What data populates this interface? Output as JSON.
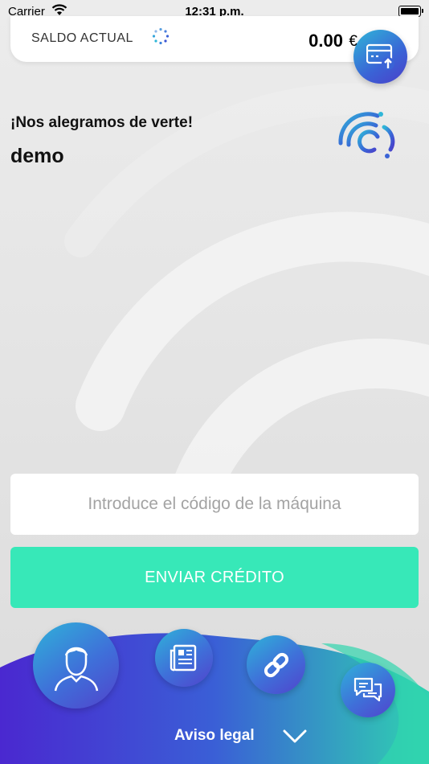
{
  "status_bar": {
    "carrier": "Carrier",
    "time": "12:31 p.m."
  },
  "balance": {
    "label": "SALDO ACTUAL",
    "amount": "0.00",
    "currency": "€",
    "topup_icon": "card-upload-icon"
  },
  "welcome": {
    "greeting": "¡Nos alegramos de verte!",
    "username": "demo"
  },
  "code_entry": {
    "placeholder": "Introduce el código de la máquina",
    "value": ""
  },
  "send_button": {
    "label": "ENVIAR CRÉDITO"
  },
  "bottom_nav": {
    "items": [
      {
        "name": "profile",
        "icon": "user-icon"
      },
      {
        "name": "news",
        "icon": "newspaper-icon"
      },
      {
        "name": "links",
        "icon": "link-icon"
      },
      {
        "name": "chat",
        "icon": "chat-bubbles-icon"
      }
    ],
    "legal_label": "Aviso legal",
    "chevron_icon": "chevron-down-icon"
  },
  "colors": {
    "accent_green": "#37e8b8",
    "gradient_start": "#2fb2d9",
    "gradient_end": "#5143cc",
    "wave_start": "#4a2bd0",
    "wave_end": "#2fd3b0"
  }
}
